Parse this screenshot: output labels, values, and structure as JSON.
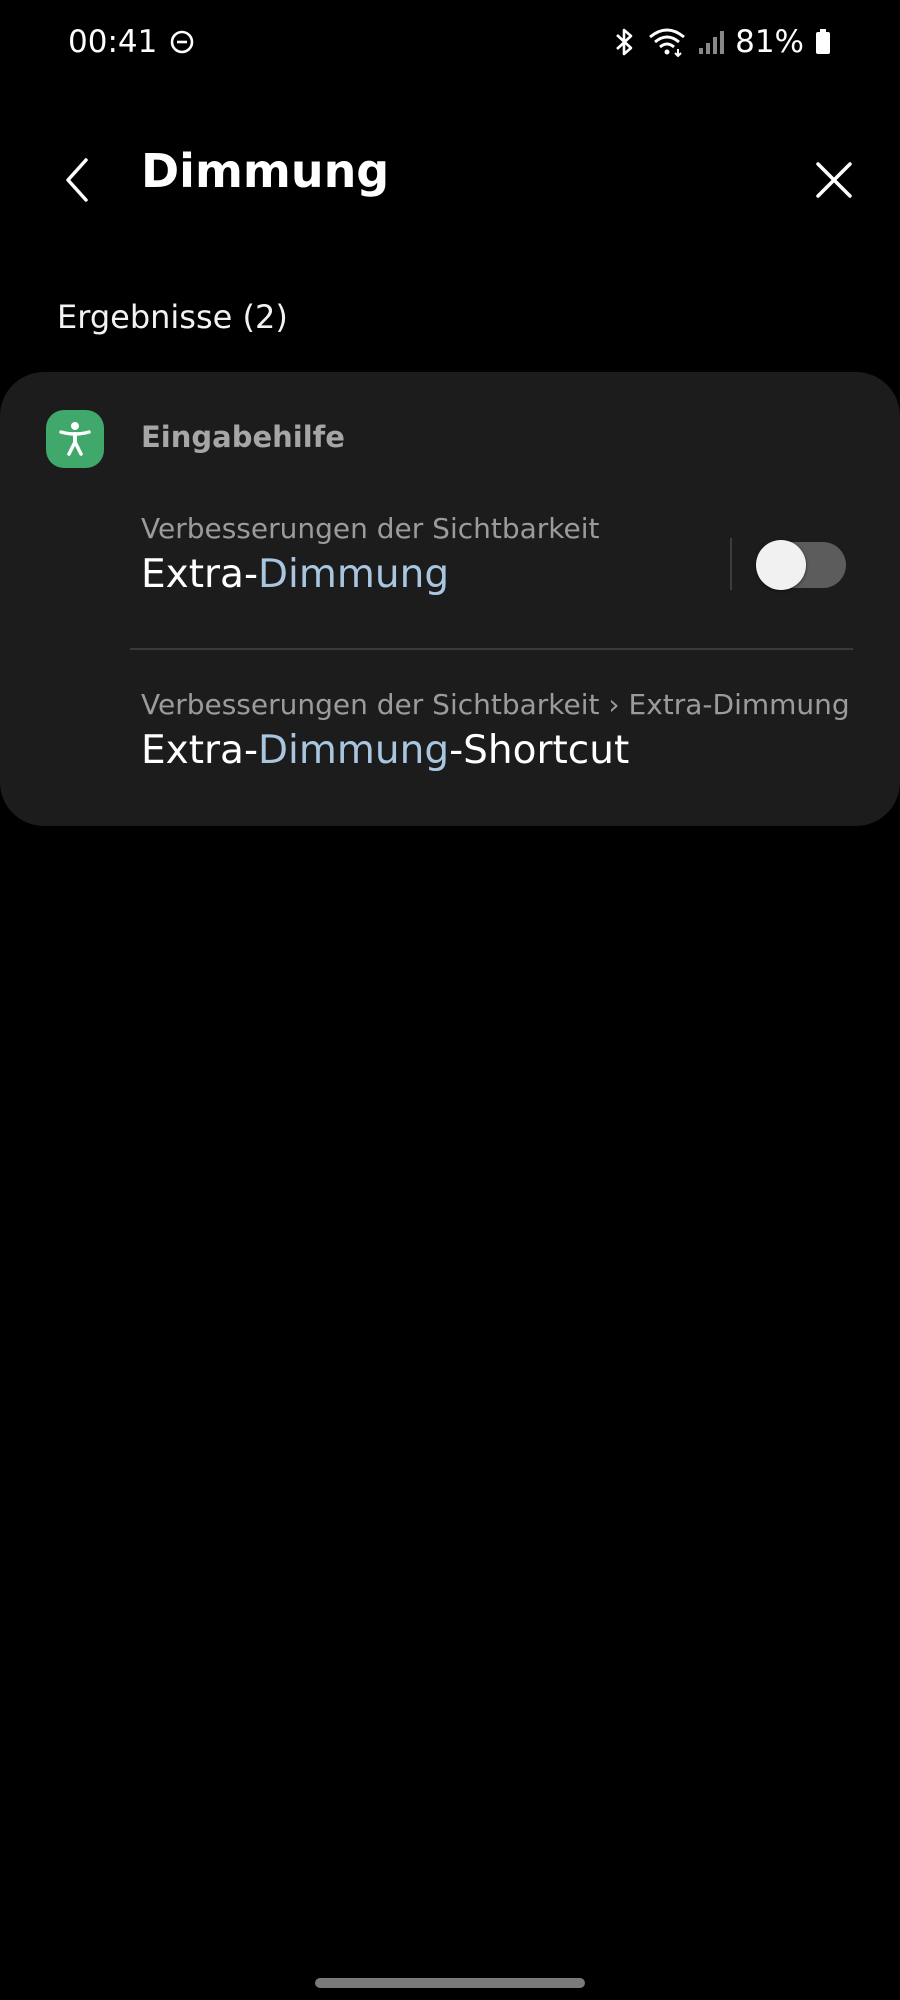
{
  "status_bar": {
    "time": "00:41",
    "battery": "81%",
    "icons": [
      "dnd-icon",
      "bluetooth-icon",
      "wifi-icon",
      "signal-icon",
      "battery-icon"
    ]
  },
  "search": {
    "query": "Dimmung"
  },
  "results": {
    "header": "Ergebnisse (2)",
    "category": {
      "label": "Eingabehilfe",
      "icon": "accessibility-icon",
      "icon_color": "#3fa86a"
    },
    "items": [
      {
        "breadcrumb": "Verbesserungen der Sichtbarkeit",
        "title_prefix": "Extra-",
        "title_highlight": "Dimmung",
        "title_suffix": "",
        "toggle_on": false
      },
      {
        "breadcrumb": "Verbesserungen der Sichtbarkeit › Extra-Dimmung",
        "title_prefix": "Extra-",
        "title_highlight": "Dimmung",
        "title_suffix": "-Shortcut"
      }
    ]
  },
  "colors": {
    "background": "#000000",
    "card": "#1c1c1c",
    "highlight": "#a9c6e0"
  }
}
